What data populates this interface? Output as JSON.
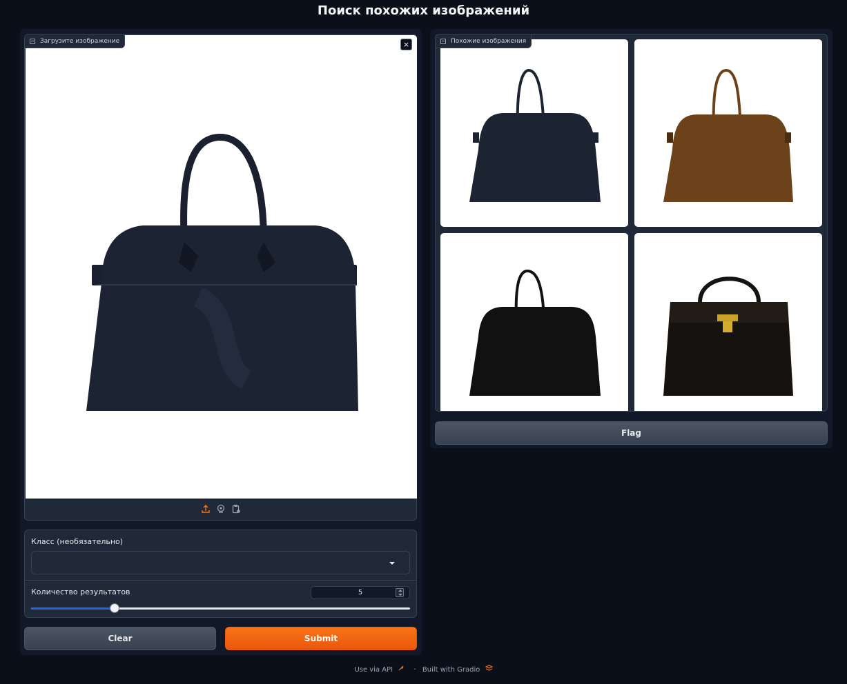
{
  "page": {
    "title": "Поиск похожих изображений"
  },
  "input_image": {
    "label": "Загрузите изображение",
    "close_symbol": "×",
    "sources": [
      {
        "name": "upload-icon",
        "color": "#f97316"
      },
      {
        "name": "webcam-icon",
        "color": "#9ca3af"
      },
      {
        "name": "clipboard-icon",
        "color": "#9ca3af"
      }
    ]
  },
  "class_field": {
    "label": "Класс (необязательно)",
    "value": ""
  },
  "results_count": {
    "label": "Количество результатов",
    "value": "5",
    "slider_fraction": 0.22
  },
  "buttons": {
    "clear": "Clear",
    "submit": "Submit",
    "flag": "Flag"
  },
  "gallery": {
    "label": "Похожие изображения",
    "items": [
      {
        "icon": "navy-leather-tote",
        "color": "#1c2331"
      },
      {
        "icon": "brown-suede-tote",
        "color": "#6b4219"
      },
      {
        "icon": "black-suede-tote",
        "color": "#111111"
      },
      {
        "icon": "black-kelly-handbag",
        "color": "#15120f"
      }
    ]
  },
  "footer": {
    "api": "Use via API",
    "separator": "·",
    "built": "Built with Gradio"
  },
  "colors": {
    "accent": "#f97316",
    "slider": "#2563eb",
    "background": "#0b0f19"
  }
}
